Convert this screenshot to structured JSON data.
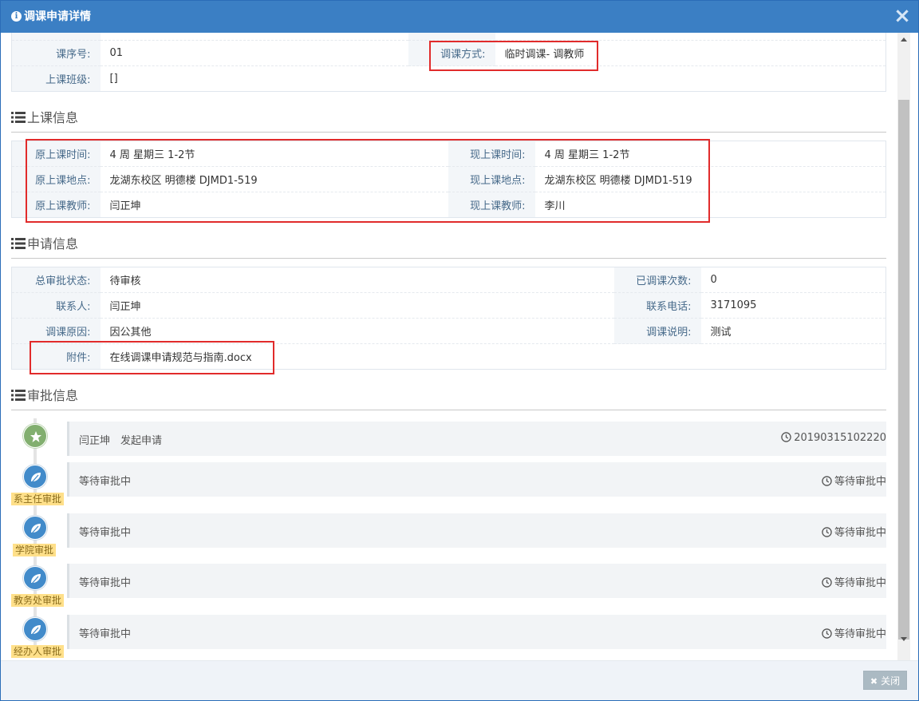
{
  "dialog": {
    "title": "调课申请详情",
    "info_icon": "info-icon",
    "close_icon": "close-icon"
  },
  "basic": {
    "course_no_label": "课序号:",
    "course_no": "01",
    "method_label": "调课方式:",
    "method": "临时调课- 调教师",
    "class_label": "上课班级:",
    "class_value": "[]"
  },
  "class_info": {
    "title": "上课信息",
    "orig_time_label": "原上课时间:",
    "orig_time": "4 周 星期三 1-2节",
    "new_time_label": "现上课时间:",
    "new_time": "4 周 星期三 1-2节",
    "orig_place_label": "原上课地点:",
    "orig_place": "龙湖东校区 明德楼 DJMD1-519",
    "new_place_label": "现上课地点:",
    "new_place": "龙湖东校区 明德楼 DJMD1-519",
    "orig_teacher_label": "原上课教师:",
    "orig_teacher": "闫正坤",
    "new_teacher_label": "现上课教师:",
    "new_teacher": "李川"
  },
  "apply_info": {
    "title": "申请信息",
    "status_label": "总审批状态:",
    "status": "待审核",
    "count_label": "已调课次数:",
    "count": "0",
    "contact_label": "联系人:",
    "contact": "闫正坤",
    "phone_label": "联系电话:",
    "phone": "3171095",
    "reason_label": "调课原因:",
    "reason": "因公其他",
    "note_label": "调课说明:",
    "note": "测试",
    "attach_label": "附件:",
    "attach": "在线调课申请规范与指南.docx"
  },
  "approval": {
    "title": "审批信息",
    "steps": [
      {
        "tag": "",
        "text": "闫正坤　发起申请",
        "time": "20190315102220",
        "icon": "star-icon"
      },
      {
        "tag": "系主任审批",
        "text": "等待审批中",
        "time": "等待审批中",
        "icon": "leaf-icon"
      },
      {
        "tag": "学院审批",
        "text": "等待审批中",
        "time": "等待审批中",
        "icon": "leaf-icon"
      },
      {
        "tag": "教务处审批",
        "text": "等待审批中",
        "time": "等待审批中",
        "icon": "leaf-icon"
      },
      {
        "tag": "经办人审批",
        "text": "等待审批中",
        "time": "等待审批中",
        "icon": "leaf-icon"
      }
    ]
  },
  "footer": {
    "close_label": "关闭"
  },
  "colors": {
    "header": "#3b7fc4",
    "highlight": "#e12b2b",
    "red_text": "#dd5a43",
    "link": "#3b82c4",
    "tag": "#ffe08a"
  }
}
